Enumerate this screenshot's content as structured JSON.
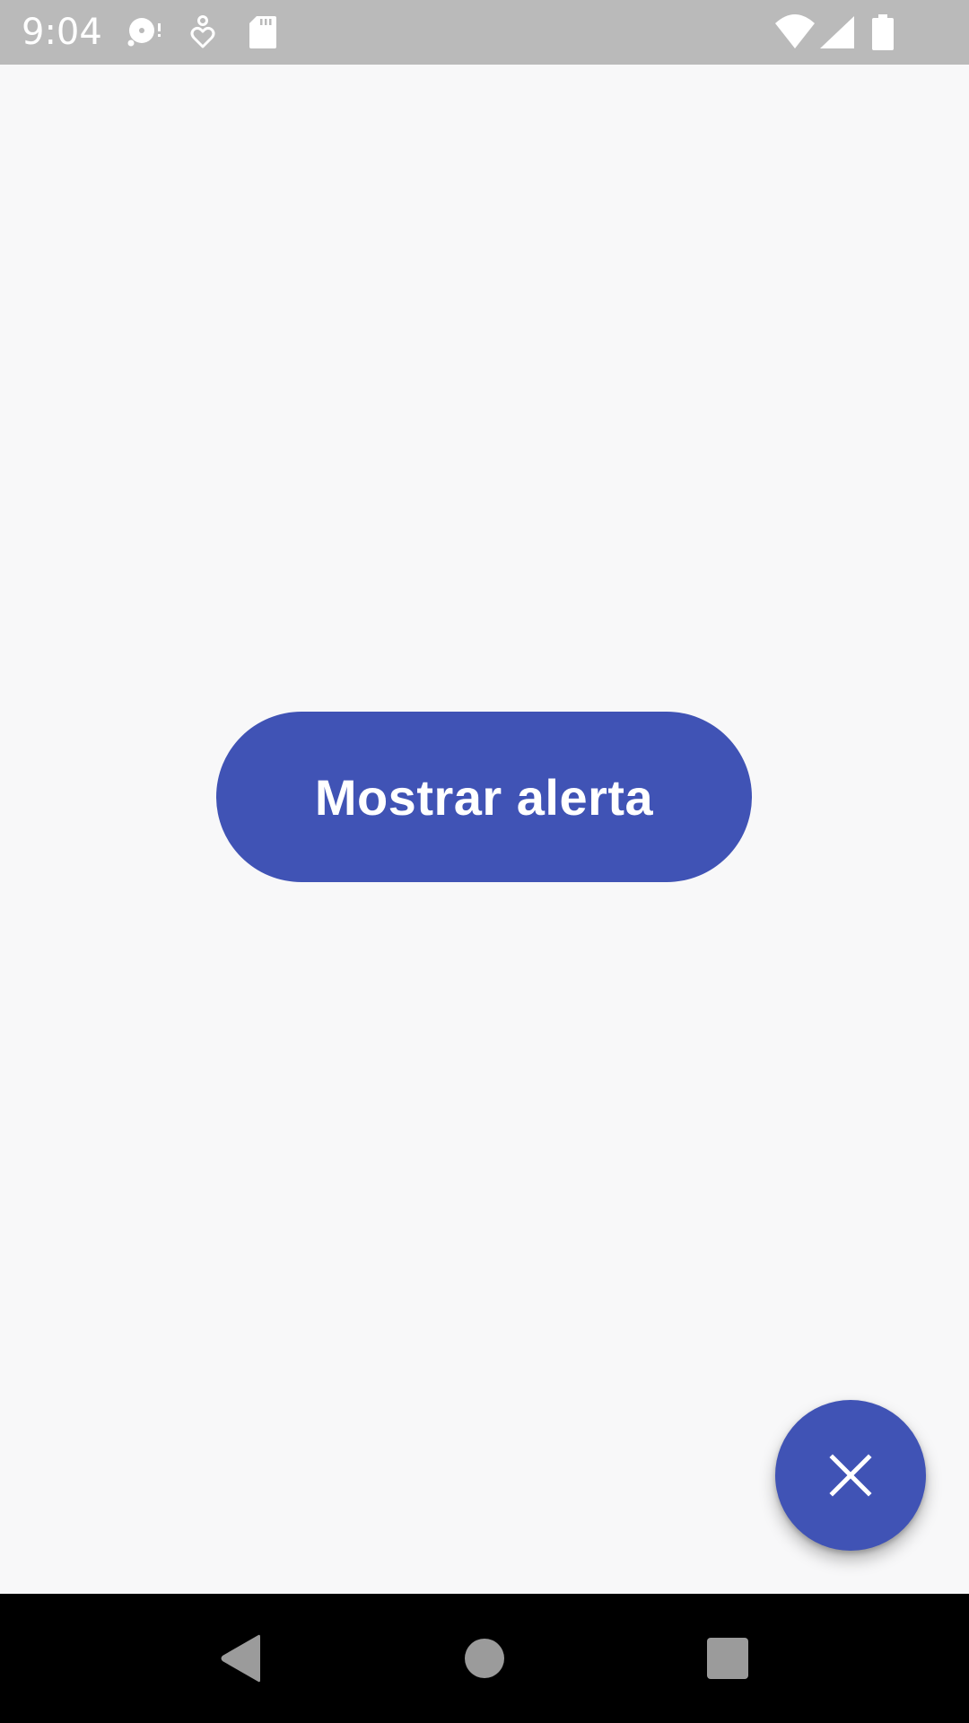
{
  "status_bar": {
    "time": "9:04",
    "left_icons": [
      "media-disc-icon",
      "heart-pin-icon",
      "sd-card-icon"
    ],
    "right_icons": [
      "wifi-icon",
      "cell-signal-icon",
      "battery-icon"
    ],
    "background": "#bababa"
  },
  "main": {
    "button_label": "Mostrar alerta",
    "accent_color": "#4053b5",
    "background": "#f8f8f9"
  },
  "fab": {
    "icon": "close-icon"
  },
  "nav_bar": {
    "buttons": [
      "back-icon",
      "home-icon",
      "recents-icon"
    ]
  }
}
